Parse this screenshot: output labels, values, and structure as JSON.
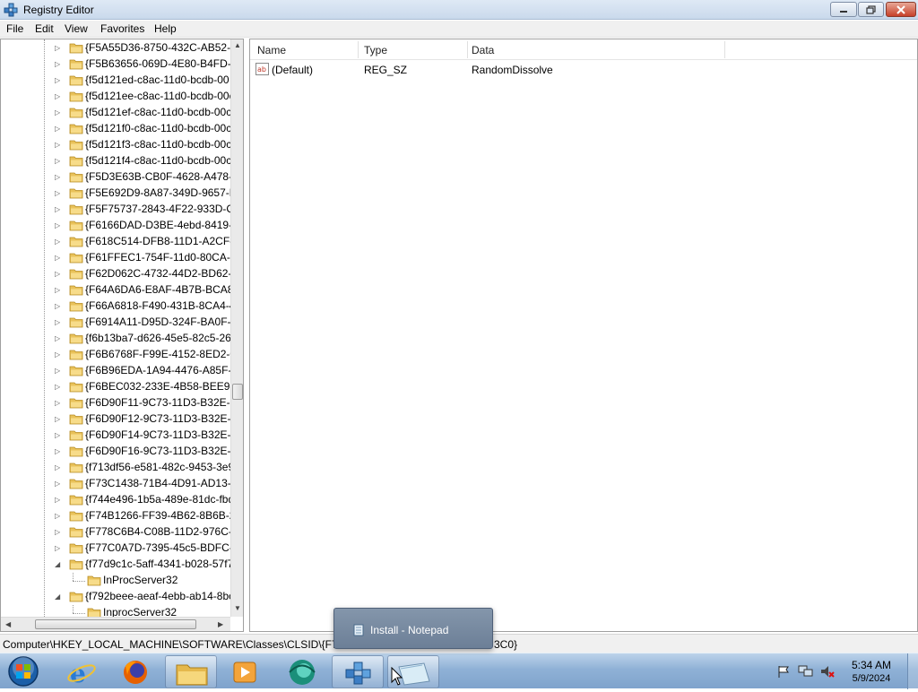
{
  "window": {
    "title": "Registry Editor"
  },
  "menu": [
    "File",
    "Edit",
    "View",
    "Favorites",
    "Help"
  ],
  "tree": {
    "items": [
      "{F5A55D36-8750-432C-AB52-A",
      "{F5B63656-069D-4E80-B4FD-9E",
      "{f5d121ed-c8ac-11d0-bcdb-00",
      "{f5d121ee-c8ac-11d0-bcdb-00c",
      "{f5d121ef-c8ac-11d0-bcdb-00c",
      "{f5d121f0-c8ac-11d0-bcdb-00c",
      "{f5d121f3-c8ac-11d0-bcdb-00c",
      "{f5d121f4-c8ac-11d0-bcdb-00c",
      "{F5D3E63B-CB0F-4628-A478-6I",
      "{F5E692D9-8A87-349D-9657-F9",
      "{F5F75737-2843-4F22-933D-C7",
      "{F6166DAD-D3BE-4ebd-8419-9",
      "{F618C514-DFB8-11D1-A2CF-0",
      "{F61FFEC1-754F-11d0-80CA-00",
      "{F62D062C-4732-44D2-BD62-1:",
      "{F64A6DA6-E8AF-4B7B-BCA8-8",
      "{F66A6818-F490-431B-8CA4-4",
      "{F6914A11-D95D-324F-BA0F-3",
      "{f6b13ba7-d626-45e5-82c5-26e",
      "{F6B6768F-F99E-4152-8ED2-04:",
      "{F6B96EDA-1A94-4476-A85F-4I",
      "{F6BEC032-233E-4B58-BEE9-DE",
      "{F6D90F11-9C73-11D3-B32E-00",
      "{F6D90F12-9C73-11D3-B32E-00",
      "{F6D90F14-9C73-11D3-B32E-00",
      "{F6D90F16-9C73-11D3-B32E-00",
      "{f713df56-e581-482c-9453-3e9:",
      "{F73C1438-71B4-4D91-AD13-1I",
      "{f744e496-1b5a-489e-81dc-fbd",
      "{F74B1266-FF39-4B62-8B6B-29",
      "{F778C6B4-C08B-11D2-976C-0(",
      "{F77C0A7D-7395-45c5-BDFC-B",
      "{f77d9c1c-5aff-4341-b028-57f7",
      "InProcServer32",
      "{f792beee-aeaf-4ebb-ab14-8bc",
      "InprocServer32"
    ]
  },
  "values": {
    "columns": [
      "Name",
      "Type",
      "Data"
    ],
    "rows": [
      {
        "name": "(Default)",
        "type": "REG_SZ",
        "data": "RandomDissolve"
      }
    ]
  },
  "status": {
    "path": "Computer\\HKEY_LOCAL_MACHINE\\SOFTWARE\\Classes\\CLSID\\{F7F4A",
    "path_end": "3C0}"
  },
  "taskbar": {
    "popup_label": "Install - Notepad",
    "clock_time": "5:34 AM",
    "clock_date": "5/9/2024"
  }
}
